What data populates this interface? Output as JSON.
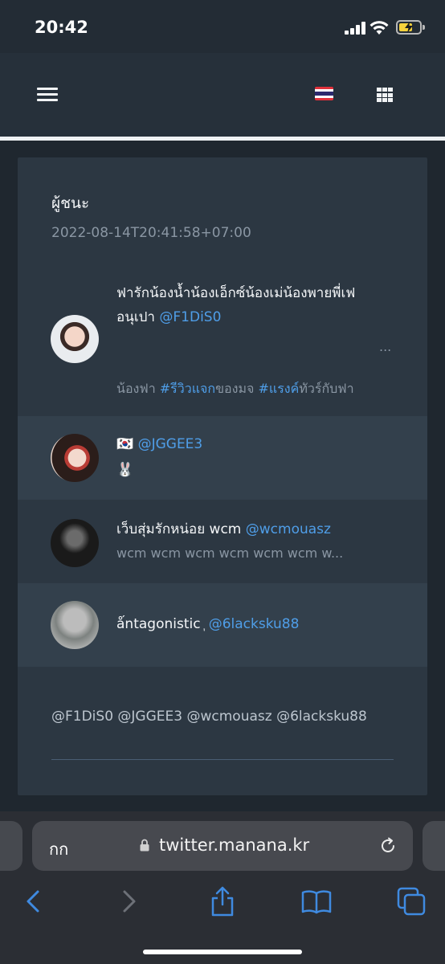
{
  "status_bar": {
    "time": "20:42"
  },
  "app_header": {
    "menu_icon": "hamburger-icon",
    "language_flag": "thailand-flag-icon",
    "apps_icon": "grid-icon"
  },
  "card": {
    "title": "ผู้ชนะ",
    "timestamp": "2022-08-14T20:41:58+07:00",
    "users": [
      {
        "name_line1": "ฟารักน้องน้ำน้องเอ็กซ์น้องเม่น้องพายพี่เฟ",
        "name_line2": "อนุเปา",
        "handle": "@F1DiS0",
        "ellipsis": "...",
        "bio_prefix": "น้องฟา ",
        "hashtag1": "#รีวิวแจก",
        "bio_mid": "ของมจ ",
        "hashtag2": "#แรงค์",
        "bio_suffix": "ทัวร์กับฟา"
      },
      {
        "name": "🇰🇷",
        "handle": "@JGGEE3",
        "bio": "🐰"
      },
      {
        "name": "เว็บสุ่มรักหน่อย wcm",
        "handle": "@wcmouasz",
        "bio": "wcm wcm wcm wcm wcm wcm w..."
      },
      {
        "name": "ǻntagonistic ᷂",
        "handle": "@6lacksku88"
      }
    ],
    "footer_handles": "@F1DiS0 @JGGEE3 @wcmouasz @6lacksku88"
  },
  "browser": {
    "aa_label": "กก",
    "url": "twitter.manana.kr"
  },
  "colors": {
    "link": "#4f9ee8",
    "card_bg": "#2c3742",
    "page_bg": "#1f272f"
  }
}
